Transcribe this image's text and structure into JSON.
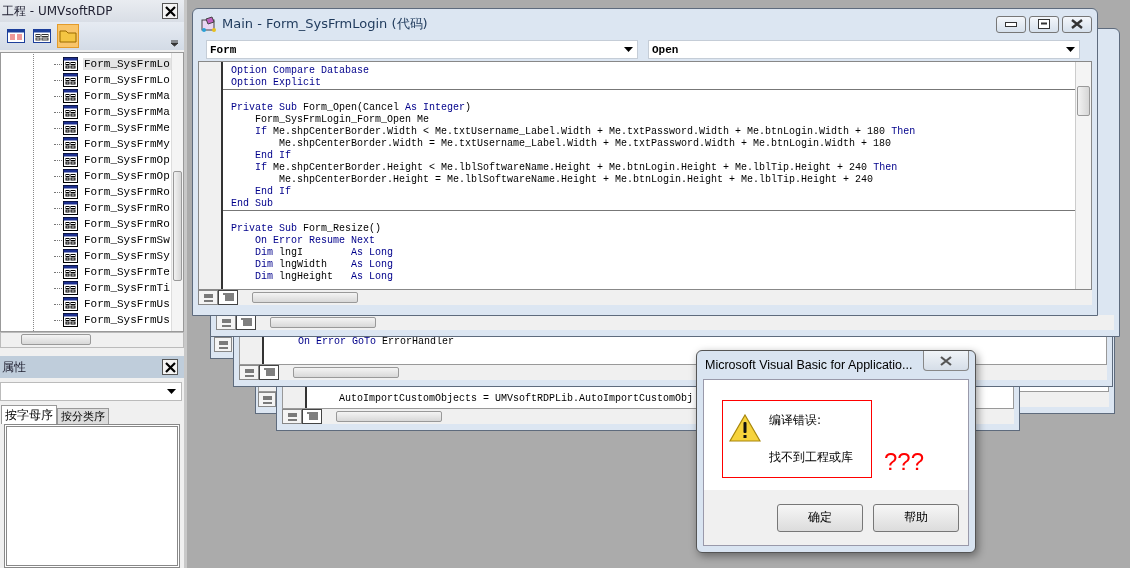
{
  "project_explorer": {
    "title": "工程 - UMVsoftRDP",
    "items": [
      {
        "label": "Form_SysFrmLo",
        "selected": true
      },
      {
        "label": "Form_SysFrmLo",
        "selected": false
      },
      {
        "label": "Form_SysFrmMa",
        "selected": false
      },
      {
        "label": "Form_SysFrmMa",
        "selected": false
      },
      {
        "label": "Form_SysFrmMe",
        "selected": false
      },
      {
        "label": "Form_SysFrmMy",
        "selected": false
      },
      {
        "label": "Form_SysFrmOp",
        "selected": false
      },
      {
        "label": "Form_SysFrmOp",
        "selected": false
      },
      {
        "label": "Form_SysFrmRo",
        "selected": false
      },
      {
        "label": "Form_SysFrmRo",
        "selected": false
      },
      {
        "label": "Form_SysFrmRo",
        "selected": false
      },
      {
        "label": "Form_SysFrmSw",
        "selected": false
      },
      {
        "label": "Form_SysFrmSy",
        "selected": false
      },
      {
        "label": "Form_SysFrmTe",
        "selected": false
      },
      {
        "label": "Form_SysFrmTi",
        "selected": false
      },
      {
        "label": "Form_SysFrmUs",
        "selected": false
      },
      {
        "label": "Form_SysFrmUs",
        "selected": false
      }
    ]
  },
  "properties": {
    "title": "属性",
    "tabs": [
      {
        "label": "按字母序",
        "selected": true
      },
      {
        "label": "按分类序",
        "selected": false
      }
    ]
  },
  "code_window": {
    "title": "Main - Form_SysFrmLogin (代码)",
    "object_combo": "Form",
    "procedure_combo": "Open",
    "procedures": [
      {
        "lines": [
          [
            {
              "kind": "keyword",
              "text": "Option Compare Database"
            }
          ],
          [
            {
              "kind": "keyword",
              "text": "Option Explicit"
            }
          ]
        ]
      },
      {
        "lines": [
          [
            {
              "kind": "keyword",
              "text": "Private Sub"
            },
            {
              "kind": "plain",
              "text": " Form_Open(Cancel "
            },
            {
              "kind": "keyword",
              "text": "As Integer"
            },
            {
              "kind": "plain",
              "text": ")"
            }
          ],
          [
            {
              "kind": "plain",
              "text": "    Form_SysFrmLogin_Form_Open Me"
            }
          ],
          [
            {
              "kind": "keyword",
              "text": "    If"
            },
            {
              "kind": "plain",
              "text": " Me.shpCenterBorder.Width < Me.txtUsername_Label.Width + Me.txtPassword.Width + Me.btnLogin.Width + 180 "
            },
            {
              "kind": "keyword",
              "text": "Then"
            }
          ],
          [
            {
              "kind": "plain",
              "text": "        Me.shpCenterBorder.Width = Me.txtUsername_Label.Width + Me.txtPassword.Width + Me.btnLogin.Width + 180"
            }
          ],
          [
            {
              "kind": "keyword",
              "text": "    End If"
            }
          ],
          [
            {
              "kind": "keyword",
              "text": "    If"
            },
            {
              "kind": "plain",
              "text": " Me.shpCenterBorder.Height < Me.lblSoftwareName.Height + Me.btnLogin.Height + Me.lblTip.Height + 240 "
            },
            {
              "kind": "keyword",
              "text": "Then"
            }
          ],
          [
            {
              "kind": "plain",
              "text": "        Me.shpCenterBorder.Height = Me.lblSoftwareName.Height + Me.btnLogin.Height + Me.lblTip.Height + 240"
            }
          ],
          [
            {
              "kind": "keyword",
              "text": "    End If"
            }
          ],
          [
            {
              "kind": "keyword",
              "text": "End Sub"
            }
          ]
        ]
      },
      {
        "lines": [
          [
            {
              "kind": "keyword",
              "text": "Private Sub"
            },
            {
              "kind": "plain",
              "text": " Form_Resize()"
            }
          ],
          [
            {
              "kind": "keyword",
              "text": "    On Error Resume Next"
            }
          ],
          [
            {
              "kind": "keyword",
              "text": "    Dim"
            },
            {
              "kind": "plain",
              "text": " lngI        "
            },
            {
              "kind": "keyword",
              "text": "As Long"
            }
          ],
          [
            {
              "kind": "keyword",
              "text": "    Dim"
            },
            {
              "kind": "plain",
              "text": " lngWidth    "
            },
            {
              "kind": "keyword",
              "text": "As Long"
            }
          ],
          [
            {
              "kind": "keyword",
              "text": "    Dim"
            },
            {
              "kind": "plain",
              "text": " lngHeight   "
            },
            {
              "kind": "keyword",
              "text": "As Long"
            }
          ]
        ]
      }
    ]
  },
  "background_code": [
    {
      "lines": [
        [
          {
            "kind": "keyword",
            "text": "    On Error GoTo"
          },
          {
            "kind": "plain",
            "text": " ErrorHandler"
          }
        ]
      ]
    },
    {
      "lines": [
        [
          {
            "kind": "plain",
            "text": "    AutoImportCustomObjects = UMVsoftRDPLib.AutoImportCustomObj"
          }
        ]
      ]
    }
  ],
  "dialog": {
    "title": "Microsoft Visual Basic for Applicatio...",
    "heading": "编译错误:",
    "message": "找不到工程或库",
    "annotation": "???",
    "buttons": [
      "确定",
      "帮助"
    ]
  }
}
